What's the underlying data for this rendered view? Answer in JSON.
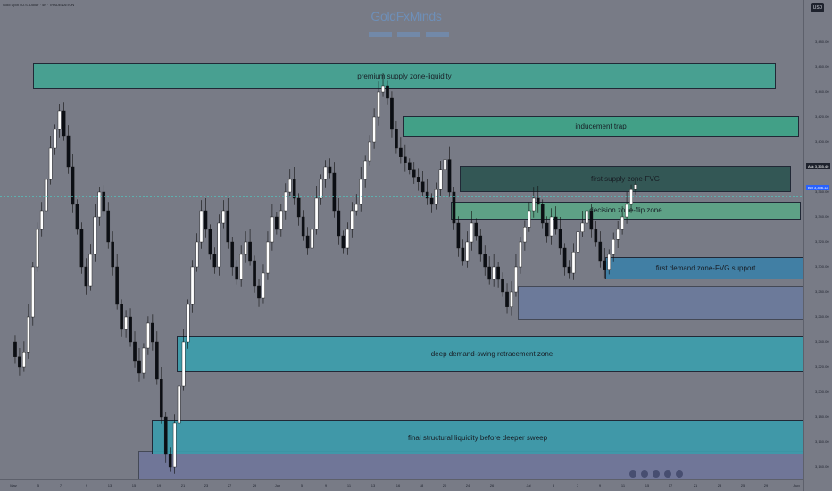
{
  "header": {
    "symbol_line": "Gold Spot / U.S. Dollar · 4h · TRADENATION"
  },
  "brand": {
    "name": "GoldFxMinds"
  },
  "currency_button": "USD",
  "price_tags": {
    "ask_label": "Ask",
    "ask_price": "3,365.40",
    "bid_label": "Bid",
    "bid_price": "3,356.12"
  },
  "chart_data": {
    "type": "candlestick",
    "ylim": [
      3130,
      3500
    ],
    "y_ticks": [
      "3,480.00",
      "3,460.00",
      "3,440.00",
      "3,420.00",
      "3,400.00",
      "3,380.00",
      "3,360.00",
      "3,340.00",
      "3,320.00",
      "3,300.00",
      "3,280.00",
      "3,260.00",
      "3,240.00",
      "3,220.00",
      "3,200.00",
      "3,180.00",
      "3,160.00",
      "3,140.00"
    ],
    "x_ticks": [
      "May",
      "5",
      "7",
      "9",
      "13",
      "15",
      "19",
      "21",
      "23",
      "27",
      "29",
      "Jun",
      "5",
      "9",
      "11",
      "13",
      "16",
      "18",
      "20",
      "24",
      "26",
      "Jul",
      "3",
      "7",
      "9",
      "11",
      "15",
      "17",
      "21",
      "23",
      "25",
      "29",
      "Aug"
    ],
    "zones": [
      {
        "label": "premium supply zone-liquidity",
        "color": "#45a493",
        "top": 3463,
        "bottom": 3442
      },
      {
        "label": "inducement trap",
        "color": "#3ea488",
        "top": 3421,
        "bottom": 3404
      },
      {
        "label": "first supply zone-FVG",
        "color": "#2e5551",
        "top": 3381,
        "bottom": 3360
      },
      {
        "label": "decision zone-flip zone",
        "color": "#5ca587",
        "top": 3352,
        "bottom": 3338
      },
      {
        "label": "first demand zone-FVG support",
        "color": "#3d80a7",
        "top": 3308,
        "bottom": 3290
      },
      {
        "label": "",
        "color": "#637aab",
        "top": 3285,
        "bottom": 3258
      },
      {
        "label": "deep demand-swing retracement zone",
        "color": "#3d9eac",
        "top": 3245,
        "bottom": 3216
      },
      {
        "label": "final structural liquidity before deeper sweep",
        "color": "#3c9bab",
        "top": 3177,
        "bottom": 3150
      },
      {
        "label": "",
        "color": "#6a72a8",
        "top": 3153,
        "bottom": 3130
      }
    ],
    "series": [
      {
        "values": [
          3240,
          3228,
          3220,
          3232,
          3260,
          3300,
          3330,
          3345,
          3370,
          3395,
          3410,
          3425,
          3405,
          3380,
          3350,
          3330,
          3300,
          3285,
          3310,
          3340,
          3360,
          3345,
          3320,
          3300,
          3270,
          3250,
          3260,
          3240,
          3225,
          3215,
          3235,
          3255,
          3240,
          3210,
          3180,
          3150,
          3140,
          3175,
          3205,
          3240,
          3270,
          3300,
          3320,
          3345,
          3330,
          3310,
          3300,
          3335,
          3345,
          3320,
          3300,
          3290,
          3310,
          3320,
          3305,
          3285,
          3275,
          3295,
          3320,
          3340,
          3330,
          3345,
          3360,
          3370,
          3355,
          3340,
          3325,
          3315,
          3330,
          3355,
          3370,
          3380,
          3375,
          3345,
          3325,
          3315,
          3330,
          3345,
          3350,
          3370,
          3385,
          3400,
          3420,
          3440,
          3445,
          3435,
          3410,
          3395,
          3388,
          3383,
          3378,
          3372,
          3368,
          3360,
          3355,
          3350,
          3362,
          3378,
          3386,
          3360,
          3335,
          3315,
          3305,
          3320,
          3335,
          3325,
          3310,
          3300,
          3290,
          3300,
          3290,
          3280,
          3268,
          3280,
          3300,
          3320,
          3332,
          3345,
          3355,
          3350,
          3335,
          3325,
          3340,
          3330,
          3315,
          3300,
          3295,
          3312,
          3328,
          3335,
          3345,
          3330,
          3320,
          3305,
          3298,
          3310,
          3322,
          3330,
          3340,
          3350,
          3362,
          3366
        ]
      }
    ]
  }
}
